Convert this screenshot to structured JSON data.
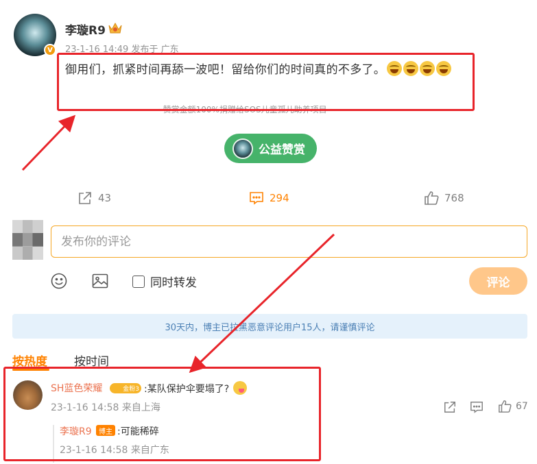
{
  "post": {
    "username": "李璇R9",
    "meta": "23-1-16 14:49 发布于 广东",
    "text": "御用们，抓紧时间再舔一波吧！留给你们的时间真的不多了。",
    "reward_note": "赞赏金额100%捐赠给SOS儿童孤儿助养项目",
    "reward_button": "公益赞赏",
    "verified_badge": "V"
  },
  "actions": {
    "share_count": "43",
    "comment_count": "294",
    "like_count": "768"
  },
  "composer": {
    "placeholder": "发布你的评论",
    "repost_label": "同时转发",
    "submit_label": "评论"
  },
  "notice": "30天内，博主已拉黑恶意评论用户15人，请谨慎评论",
  "tabs": {
    "hot": "按热度",
    "time": "按时间"
  },
  "comment": {
    "username": "SH蓝色荣耀",
    "badge": "金粉3",
    "text": ":某队保护伞要塌了?",
    "meta": "23-1-16 14:58 来自上海",
    "like_count": "67"
  },
  "reply": {
    "username": "李璇R9",
    "badge": "博主",
    "text": ":可能稀碎",
    "meta": "23-1-16 14:58 来自广东"
  },
  "colors": {
    "accent": "#ff8200",
    "green": "#46b36a",
    "annotation_red": "#e8242a",
    "link_user": "#eb7350"
  }
}
